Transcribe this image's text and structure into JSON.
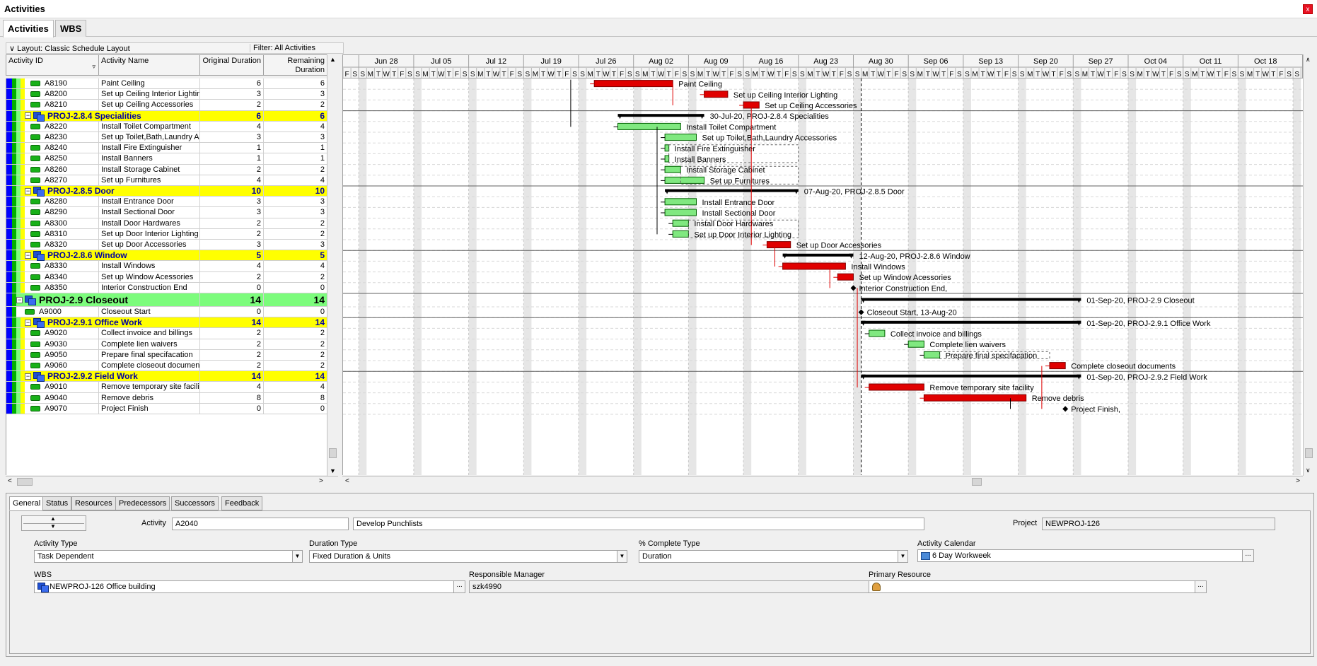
{
  "window": {
    "title": "Activities",
    "close_label": "x"
  },
  "tabs": [
    {
      "label": "Activities"
    },
    {
      "label": "WBS"
    }
  ],
  "toolbar": {
    "layout": "Layout: Classic Schedule Layout",
    "filter": "Filter: All Activities"
  },
  "columns": {
    "activity_id": "Activity ID",
    "activity_name": "Activity Name",
    "original_duration": "Original Duration",
    "remaining_duration_1": "Remaining",
    "remaining_duration_2": "Duration"
  },
  "rows": [
    {
      "type": "act",
      "id": "A8190",
      "name": "Paint Ceiling",
      "od": "6",
      "rd": "6"
    },
    {
      "type": "act",
      "id": "A8200",
      "name": "Set up Ceiling Interior Lighting",
      "od": "3",
      "rd": "3"
    },
    {
      "type": "act",
      "id": "A8210",
      "name": "Set up Ceiling Accessories",
      "od": "2",
      "rd": "2"
    },
    {
      "type": "wbs",
      "id": "PROJ-2.8.4",
      "name": "Specialities",
      "od": "6",
      "rd": "6"
    },
    {
      "type": "act",
      "id": "A8220",
      "name": "Install Toilet Compartment",
      "od": "4",
      "rd": "4"
    },
    {
      "type": "act",
      "id": "A8230",
      "name": "Set up Toilet,Bath,Laundry Accessories",
      "od": "3",
      "rd": "3"
    },
    {
      "type": "act",
      "id": "A8240",
      "name": "Install Fire Extinguisher",
      "od": "1",
      "rd": "1"
    },
    {
      "type": "act",
      "id": "A8250",
      "name": "Install Banners",
      "od": "1",
      "rd": "1"
    },
    {
      "type": "act",
      "id": "A8260",
      "name": "Install Storage Cabinet",
      "od": "2",
      "rd": "2"
    },
    {
      "type": "act",
      "id": "A8270",
      "name": "Set up Furnitures",
      "od": "4",
      "rd": "4"
    },
    {
      "type": "wbs",
      "id": "PROJ-2.8.5",
      "name": "Door",
      "od": "10",
      "rd": "10"
    },
    {
      "type": "act",
      "id": "A8280",
      "name": "Install Entrance Door",
      "od": "3",
      "rd": "3"
    },
    {
      "type": "act",
      "id": "A8290",
      "name": "Install Sectional Door",
      "od": "3",
      "rd": "3"
    },
    {
      "type": "act",
      "id": "A8300",
      "name": "Install Door Hardwares",
      "od": "2",
      "rd": "2"
    },
    {
      "type": "act",
      "id": "A8310",
      "name": "Set up Door Interior Lighting",
      "od": "2",
      "rd": "2"
    },
    {
      "type": "act",
      "id": "A8320",
      "name": "Set up Door Accessories",
      "od": "3",
      "rd": "3"
    },
    {
      "type": "wbs",
      "id": "PROJ-2.8.6",
      "name": "Window",
      "od": "5",
      "rd": "5"
    },
    {
      "type": "act",
      "id": "A8330",
      "name": "Install Windows",
      "od": "4",
      "rd": "4"
    },
    {
      "type": "act",
      "id": "A8340",
      "name": "Set up Window Acessories",
      "od": "2",
      "rd": "2"
    },
    {
      "type": "act",
      "id": "A8350",
      "name": "Interior Construction End",
      "od": "0",
      "rd": "0"
    },
    {
      "type": "wbs2",
      "id": "PROJ-2.9",
      "name": "Closeout",
      "od": "14",
      "rd": "14"
    },
    {
      "type": "act2",
      "id": "A9000",
      "name": "Closeout Start",
      "od": "0",
      "rd": "0"
    },
    {
      "type": "wbs",
      "id": "PROJ-2.9.1",
      "name": "Office Work",
      "od": "14",
      "rd": "14"
    },
    {
      "type": "act",
      "id": "A9020",
      "name": "Collect invoice and billings",
      "od": "2",
      "rd": "2"
    },
    {
      "type": "act",
      "id": "A9030",
      "name": "Complete lien waivers",
      "od": "2",
      "rd": "2"
    },
    {
      "type": "act",
      "id": "A9050",
      "name": "Prepare final specifacation",
      "od": "2",
      "rd": "2"
    },
    {
      "type": "act",
      "id": "A9060",
      "name": "Complete closeout documents",
      "od": "2",
      "rd": "2"
    },
    {
      "type": "wbs",
      "id": "PROJ-2.9.2",
      "name": "Field Work",
      "od": "14",
      "rd": "14"
    },
    {
      "type": "act",
      "id": "A9010",
      "name": "Remove temporary  site facility",
      "od": "4",
      "rd": "4"
    },
    {
      "type": "act",
      "id": "A9040",
      "name": "Remove debris",
      "od": "8",
      "rd": "8"
    },
    {
      "type": "act",
      "id": "A9070",
      "name": "Project Finish",
      "od": "0",
      "rd": "0"
    }
  ],
  "gantt": {
    "week_labels": [
      "Jun 28",
      "Jul 05",
      "Jul 12",
      "Jul 19",
      "Jul 26",
      "Aug 02",
      "Aug 09",
      "Aug 16",
      "Aug 23",
      "Aug 30",
      "Sep 06",
      "Sep 13",
      "Sep 20",
      "Sep 27",
      "Oct 04",
      "Oct 11",
      "Oct 18"
    ],
    "day_letters": [
      "S",
      "M",
      "T",
      "W",
      "T",
      "F",
      "S"
    ],
    "first_day_letter": "F",
    "bars": [
      {
        "row": 0,
        "start": 32,
        "dur": 10,
        "kind": "crit",
        "label": "Paint Ceiling"
      },
      {
        "row": 1,
        "start": 46,
        "dur": 3,
        "kind": "crit",
        "label": "Set up Ceiling Interior Lighting"
      },
      {
        "row": 2,
        "start": 51,
        "dur": 2,
        "kind": "crit",
        "label": "Set up Ceiling Accessories"
      },
      {
        "row": 3,
        "start": 35,
        "dur": 11,
        "kind": "summary",
        "label": "30-Jul-20, PROJ-2.8.4  Specialities"
      },
      {
        "row": 4,
        "start": 35,
        "dur": 8,
        "kind": "normal",
        "label": "Install Toilet Compartment"
      },
      {
        "row": 5,
        "start": 41,
        "dur": 4,
        "kind": "normal",
        "label": "Set up Toilet,Bath,Laundry Accessories"
      },
      {
        "row": 6,
        "start": 41,
        "dur": 0.5,
        "kind": "normal",
        "label": "Install Fire Extinguisher"
      },
      {
        "row": 7,
        "start": 41,
        "dur": 0.5,
        "kind": "normal",
        "label": "Install Banners"
      },
      {
        "row": 8,
        "start": 41,
        "dur": 2,
        "kind": "normal",
        "label": "Install Storage Cabinet"
      },
      {
        "row": 9,
        "start": 41,
        "dur": 5,
        "kind": "normal",
        "label": "Set up Furnitures"
      },
      {
        "row": 10,
        "start": 41,
        "dur": 17,
        "kind": "summary",
        "label": "07-Aug-20, PROJ-2.8.5  Door"
      },
      {
        "row": 11,
        "start": 41,
        "dur": 4,
        "kind": "normal",
        "label": "Install Entrance Door"
      },
      {
        "row": 12,
        "start": 41,
        "dur": 4,
        "kind": "normal",
        "label": "Install Sectional Door"
      },
      {
        "row": 13,
        "start": 42,
        "dur": 2,
        "kind": "normal",
        "label": "Install Door Hardwares"
      },
      {
        "row": 14,
        "start": 42,
        "dur": 2,
        "kind": "normal",
        "label": "Set up Door Interior Lighting"
      },
      {
        "row": 15,
        "start": 54,
        "dur": 3,
        "kind": "crit",
        "label": "Set up Door Accessories"
      },
      {
        "row": 16,
        "start": 56,
        "dur": 9,
        "kind": "summary",
        "label": "12-Aug-20, PROJ-2.8.6  Window"
      },
      {
        "row": 17,
        "start": 56,
        "dur": 8,
        "kind": "crit",
        "label": "Install Windows"
      },
      {
        "row": 18,
        "start": 63,
        "dur": 2,
        "kind": "crit",
        "label": "Set up Window Acessories"
      },
      {
        "row": 19,
        "start": 65,
        "dur": 0,
        "kind": "milestone",
        "label": "Interior Construction End,"
      },
      {
        "row": 20,
        "start": 66,
        "dur": 28,
        "kind": "summary",
        "label": "01-Sep-20, PROJ-2.9  Closeout"
      },
      {
        "row": 21,
        "start": 66,
        "dur": 0,
        "kind": "milestone",
        "label": "Closeout Start, 13-Aug-20"
      },
      {
        "row": 22,
        "start": 66,
        "dur": 28,
        "kind": "summary",
        "label": "01-Sep-20, PROJ-2.9.1  Office Work"
      },
      {
        "row": 23,
        "start": 67,
        "dur": 2,
        "kind": "normal",
        "label": "Collect invoice and billings"
      },
      {
        "row": 24,
        "start": 72,
        "dur": 2,
        "kind": "normal",
        "label": "Complete lien waivers"
      },
      {
        "row": 25,
        "start": 74,
        "dur": 2,
        "kind": "normal",
        "label": "Prepare final specifacation"
      },
      {
        "row": 26,
        "start": 90,
        "dur": 2,
        "kind": "crit",
        "label": "Complete closeout documents"
      },
      {
        "row": 27,
        "start": 66,
        "dur": 28,
        "kind": "summary",
        "label": "01-Sep-20, PROJ-2.9.2  Field Work"
      },
      {
        "row": 28,
        "start": 67,
        "dur": 7,
        "kind": "crit",
        "label": "Remove temporary  site facility"
      },
      {
        "row": 29,
        "start": 74,
        "dur": 13,
        "kind": "crit",
        "label": "Remove debris"
      },
      {
        "row": 30,
        "start": 92,
        "dur": 0,
        "kind": "milestone",
        "label": "Project Finish,"
      }
    ]
  },
  "detail": {
    "tabs": [
      {
        "label": "General"
      },
      {
        "label": "Status"
      },
      {
        "label": "Resources"
      },
      {
        "label": "Predecessors"
      },
      {
        "label": "Successors"
      },
      {
        "label": "Feedback"
      }
    ],
    "activity_label": "Activity",
    "activity_id": "A2040",
    "activity_name": "Develop Punchlists",
    "project_label": "Project",
    "project_value": "NEWPROJ-126",
    "activity_type_label": "Activity Type",
    "activity_type_value": "Task Dependent",
    "duration_type_label": "Duration Type",
    "duration_type_value": "Fixed Duration & Units",
    "pct_type_label": "% Complete Type",
    "pct_type_value": "Duration",
    "calendar_label": "Activity Calendar",
    "calendar_value": "6 Day Workweek",
    "wbs_label": "WBS",
    "wbs_value": "NEWPROJ-126  Office building",
    "manager_label": "Responsible Manager",
    "manager_value": "szk4990",
    "resource_label": "Primary Resource",
    "resource_value": "",
    "ellipsis": "..."
  },
  "colors": {
    "critical": "#e00000",
    "normal": "#80e880",
    "wbs_row": "#ffff00",
    "wbs2_row": "#7cfc7c",
    "summary": "#000000"
  }
}
